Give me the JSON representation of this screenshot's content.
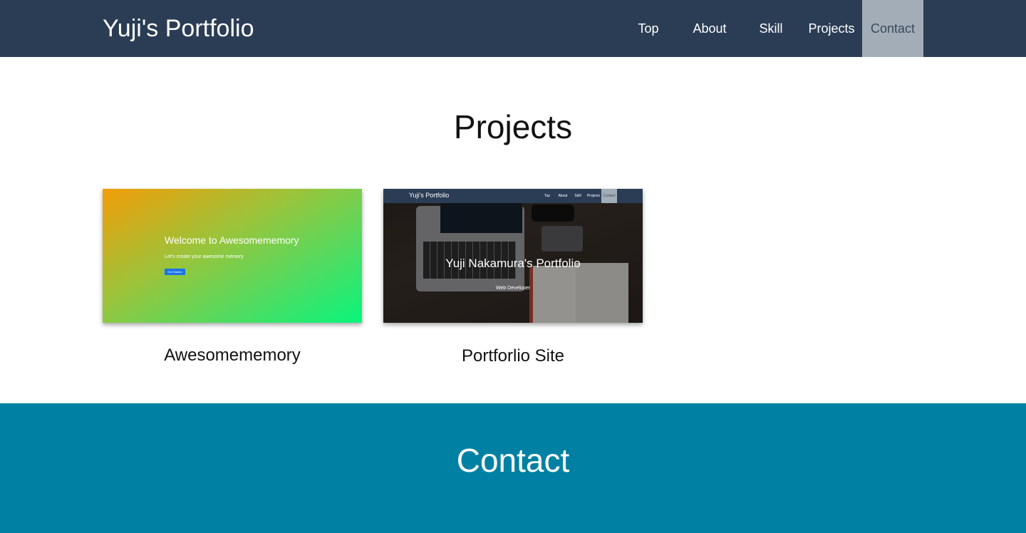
{
  "header": {
    "brand": "Yuji's Portfolio",
    "nav": [
      {
        "label": "Top"
      },
      {
        "label": "About"
      },
      {
        "label": "Skill"
      },
      {
        "label": "Projects"
      },
      {
        "label": "Contact",
        "active": true
      }
    ],
    "colors": {
      "background": "#2b3d55",
      "active": "#a3adb8"
    }
  },
  "projects": {
    "title": "Projects",
    "items": [
      {
        "title": "Awesomememory",
        "thumbnail": {
          "heading": "Welcome to Awesomememory",
          "subtitle": "Let's create your awesome memory",
          "button": "Get Started"
        }
      },
      {
        "title": "Portforlio Site",
        "thumbnail": {
          "brand": "Yuji's Portfolio",
          "nav": [
            "Top",
            "About",
            "Skill",
            "Projects",
            "Contact"
          ],
          "heading": "Yuji Nakamura's Portfolio",
          "subtitle": "Web Developer"
        }
      }
    ]
  },
  "contact": {
    "title": "Contact",
    "background": "#0081a3"
  }
}
